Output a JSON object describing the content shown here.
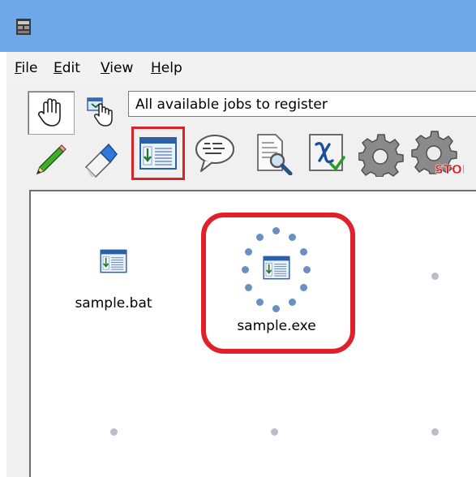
{
  "menu": {
    "items": [
      {
        "first": "F",
        "rest": "ile"
      },
      {
        "first": "E",
        "rest": "dit"
      },
      {
        "first": "V",
        "rest": "iew"
      },
      {
        "first": "H",
        "rest": "elp"
      }
    ]
  },
  "tool_palette": [
    "hand-tool",
    "drag-cursor-tool",
    "pencil-tool",
    "eraser-tool"
  ],
  "job_filter": {
    "selected": "All available jobs to register"
  },
  "toolbar": [
    "batch-job-icon",
    "speech-bubble-icon",
    "document-search-icon",
    "variable-check-icon",
    "gear-icon",
    "gear-stop-icon"
  ],
  "toolbar_stop_text": "STOP",
  "canvas": {
    "items": [
      {
        "label": "sample.bat"
      },
      {
        "label": "sample.exe"
      }
    ]
  },
  "colors": {
    "titlebar": "#6fa8e8",
    "highlight": "#d8232a",
    "dot": "#b7bec8"
  }
}
